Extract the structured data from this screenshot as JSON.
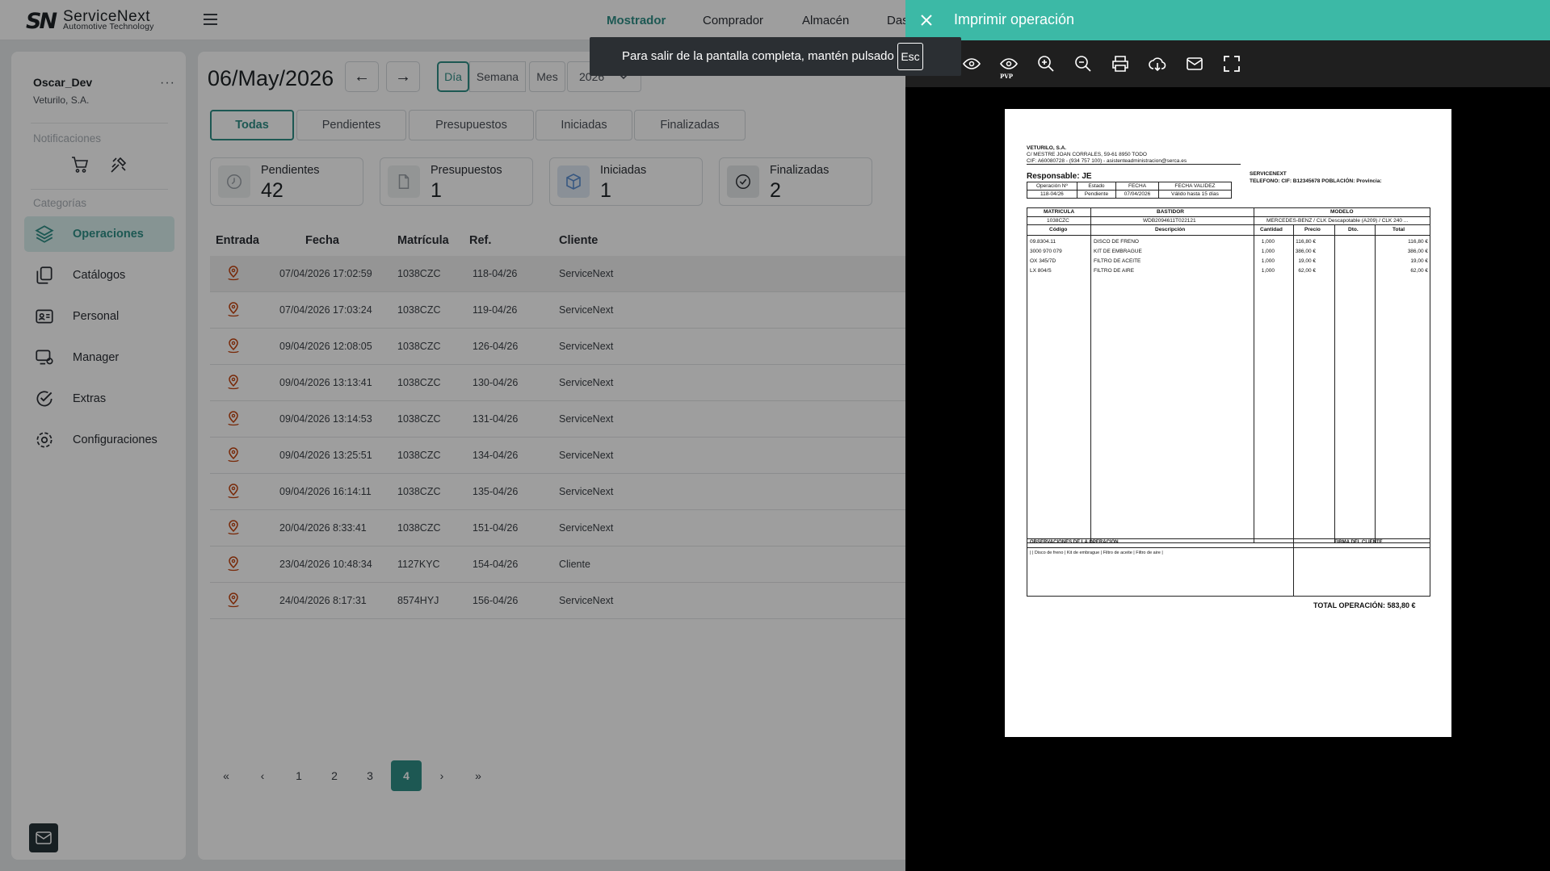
{
  "brand": {
    "mark": "SN",
    "name": "ServiceNext",
    "tagline": "Automotive Technology"
  },
  "nav": {
    "items": [
      "Mostrador",
      "Comprador",
      "Almacén",
      "Das"
    ],
    "active": "Mostrador"
  },
  "user": {
    "name": "Oscar_Dev",
    "company": "Veturilo, S.A.",
    "menu": "···"
  },
  "sidebar": {
    "notifications_label": "Notificaciones",
    "categories_label": "Categorías",
    "items": [
      {
        "label": "Operaciones",
        "icon": "layers-icon"
      },
      {
        "label": "Catálogos",
        "icon": "catalog-icon"
      },
      {
        "label": "Personal",
        "icon": "id-card-icon"
      },
      {
        "label": "Manager",
        "icon": "manager-icon"
      },
      {
        "label": "Extras",
        "icon": "checklist-icon"
      },
      {
        "label": "Configuraciones",
        "icon": "gear-icon"
      }
    ]
  },
  "main": {
    "date": "06/May/2026",
    "prev": "←",
    "next": "→",
    "modes": [
      "Día",
      "Semana",
      "Mes",
      "2026"
    ],
    "filters": [
      "Todas",
      "Pendientes",
      "Presupuestos",
      "Iniciadas",
      "Finalizadas"
    ],
    "cards": [
      {
        "label": "Pendientes",
        "value": "42"
      },
      {
        "label": "Presupuestos",
        "value": "1"
      },
      {
        "label": "Iniciadas",
        "value": "1"
      },
      {
        "label": "Finalizadas",
        "value": "2"
      }
    ],
    "columns": [
      "Entrada",
      "Fecha",
      "Matrícula",
      "Ref.",
      "Cliente"
    ],
    "rows": [
      {
        "fecha": "07/04/2026 17:02:59",
        "matricula": "1038CZC",
        "ref": "118-04/26",
        "cliente": "ServiceNext"
      },
      {
        "fecha": "07/04/2026 17:03:24",
        "matricula": "1038CZC",
        "ref": "119-04/26",
        "cliente": "ServiceNext"
      },
      {
        "fecha": "09/04/2026 12:08:05",
        "matricula": "1038CZC",
        "ref": "126-04/26",
        "cliente": "ServiceNext"
      },
      {
        "fecha": "09/04/2026 13:13:41",
        "matricula": "1038CZC",
        "ref": "130-04/26",
        "cliente": "ServiceNext"
      },
      {
        "fecha": "09/04/2026 13:14:53",
        "matricula": "1038CZC",
        "ref": "131-04/26",
        "cliente": "ServiceNext"
      },
      {
        "fecha": "09/04/2026 13:25:51",
        "matricula": "1038CZC",
        "ref": "134-04/26",
        "cliente": "ServiceNext"
      },
      {
        "fecha": "09/04/2026 16:14:11",
        "matricula": "1038CZC",
        "ref": "135-04/26",
        "cliente": "ServiceNext"
      },
      {
        "fecha": "20/04/2026 8:33:41",
        "matricula": "1038CZC",
        "ref": "151-04/26",
        "cliente": "ServiceNext"
      },
      {
        "fecha": "23/04/2026 10:48:34",
        "matricula": "1127KYC",
        "ref": "154-04/26",
        "cliente": "Cliente"
      },
      {
        "fecha": "24/04/2026 8:17:31",
        "matricula": "8574HYJ",
        "ref": "156-04/26",
        "cliente": "ServiceNext"
      }
    ],
    "pagination": {
      "first": "«",
      "prev": "‹",
      "pages": [
        "1",
        "2",
        "3",
        "4"
      ],
      "current": "4",
      "next": "›",
      "last": "»"
    }
  },
  "print_panel": {
    "title": "Imprimir operación",
    "toolbar_labels": [
      "PVP"
    ],
    "fullscreen_toast": "Para salir de la pantalla completa, mantén pulsado",
    "esc_key": "Esc"
  },
  "document": {
    "company": "VETURILO, S.A.",
    "address": "C/ MESTRE JOAN CORRALES, 59-61 8950 TODO",
    "cif_line": "CIF: A60080728 - (934 757 100) - asistenteadministracion@serca.es",
    "responsable": "Responsable: JE",
    "client_name": "SERVICENEXT",
    "client_line": "TELEFONO: CIF: B12345678 POBLACIÓN: Provincia:",
    "op_headers": [
      "Operación Nº",
      "Estado",
      "FECHA",
      "FECHA VALIDEZ"
    ],
    "op_values": [
      "118-04/26",
      "Pendiente",
      "07/04/2026",
      "Válido hasta 15 días"
    ],
    "veh_headers": [
      "MATRICULA",
      "BASTIDOR",
      "MODELO"
    ],
    "veh_values": [
      "1038CZC",
      "WDB2094611T022121",
      "MERCEDES-BENZ / CLK Descapotable (A209) / CLK 240 ..."
    ],
    "line_headers": [
      "Código",
      "Descripción",
      "Cantidad",
      "Precio",
      "Dto.",
      "Total"
    ],
    "lines": [
      {
        "codigo": "09.8304.11",
        "desc": "DISCO DE FRENO",
        "cant": "1,000",
        "precio": "116,80 €",
        "dto": "",
        "total": "116,80 €"
      },
      {
        "codigo": "3000 970 079",
        "desc": "KIT DE EMBRAGUE",
        "cant": "1,000",
        "precio": "386,00 €",
        "dto": "",
        "total": "386,00 €"
      },
      {
        "codigo": "OX 345/7D",
        "desc": "FILTRO DE ACEITE",
        "cant": "1,000",
        "precio": "19,00 €",
        "dto": "",
        "total": "19,00 €"
      },
      {
        "codigo": "LX 804/S",
        "desc": "FILTRO DE AIRE",
        "cant": "1,000",
        "precio": "62,00 €",
        "dto": "",
        "total": "62,00 €"
      }
    ],
    "obs_label": "OBSERVACIONES DE LA OPERACIÓN",
    "firma_label": "FIRMA DEL CLIENTE",
    "obs_text": "| | Disco de freno | Kit de embrague | Filtro de aceite | Filtro de aire |",
    "total": "TOTAL OPERACIÓN: 583,80 €"
  },
  "colors": {
    "accent": "#2f8f87",
    "panel_header": "#3cb9a6"
  }
}
